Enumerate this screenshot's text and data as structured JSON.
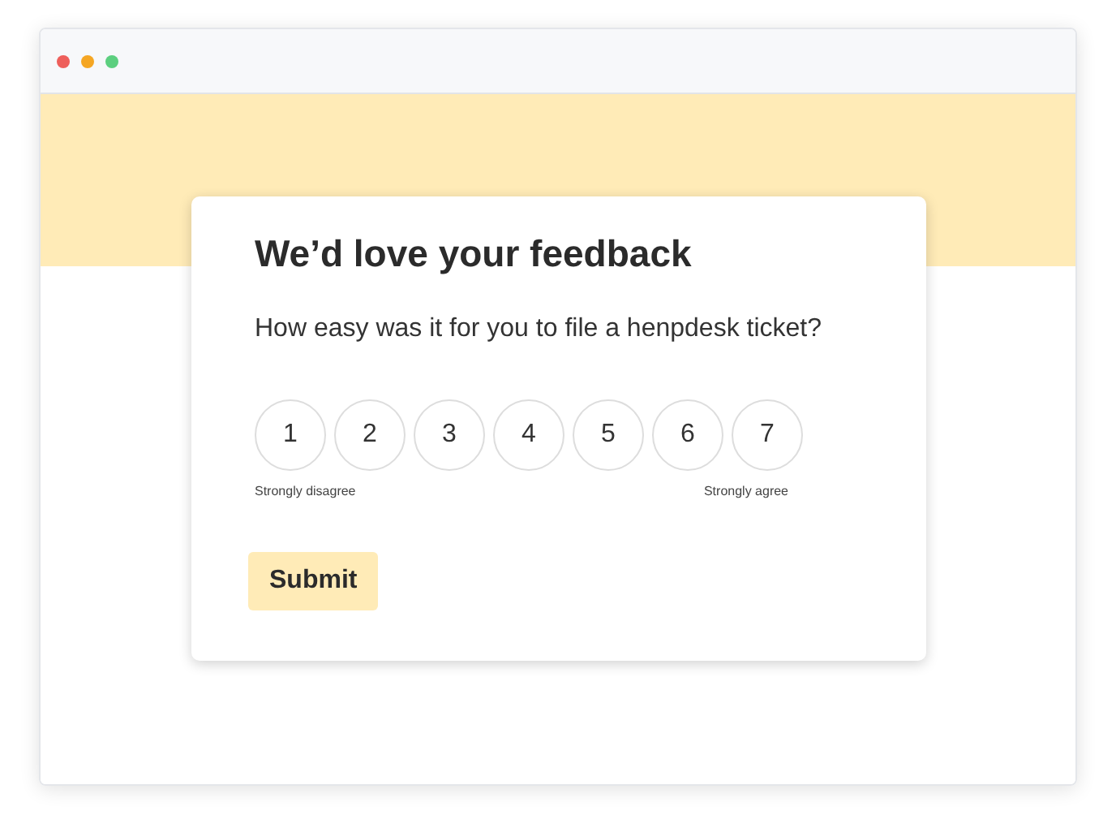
{
  "window": {
    "controls": [
      {
        "color": "#ee5f5b"
      },
      {
        "color": "#f5a623"
      },
      {
        "color": "#5ccf7f"
      }
    ]
  },
  "survey": {
    "title": "We’d love your feedback",
    "question": "How easy was it for you to file a henpdesk ticket?",
    "options": [
      {
        "label": "1",
        "selected": false
      },
      {
        "label": "2",
        "selected": false
      },
      {
        "label": "3",
        "selected": false
      },
      {
        "label": "4",
        "selected": false
      },
      {
        "label": "5",
        "selected": false
      },
      {
        "label": "6",
        "selected": false
      },
      {
        "label": "7",
        "selected": false
      }
    ],
    "min_label": "Strongly disagree",
    "max_label": "Strongly agree",
    "submit": "Submit"
  }
}
